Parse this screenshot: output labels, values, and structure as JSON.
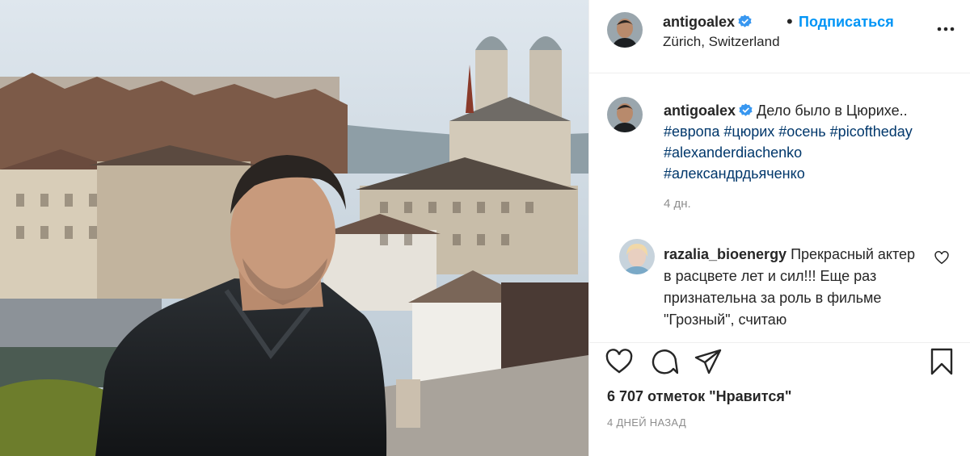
{
  "post": {
    "username": "antigoalex",
    "follow_label": "Подписаться",
    "location": "Zürich, Switzerland",
    "caption": {
      "text": "Дело было в Цюрихе..",
      "hashtags_line1": [
        "#европа",
        "#цюрих",
        "#осень",
        "#picoftheday"
      ],
      "hashtags_line2": [
        "#alexanderdiachenko"
      ],
      "hashtags_line3": [
        "#александрдьяченко"
      ],
      "time_ago": "4 дн."
    },
    "comments": [
      {
        "username": "razalia_bioenergy",
        "text": "Прекрасный актер в расцвете лет и сил!!! Еще раз признательна за роль в фильме \"Грозный\", считаю"
      }
    ],
    "likes_text": "6 707 отметок \"Нравится\"",
    "posted_ago": "4 ДНЕЙ НАЗАД"
  },
  "icons": {
    "verified": "verified-badge-icon",
    "more": "more-options-icon",
    "like": "heart-icon",
    "comment": "comment-icon",
    "share": "share-icon",
    "save": "bookmark-icon"
  },
  "colors": {
    "accent": "#0095f6",
    "hashtag": "#00376b",
    "muted": "#8e8e8e"
  }
}
